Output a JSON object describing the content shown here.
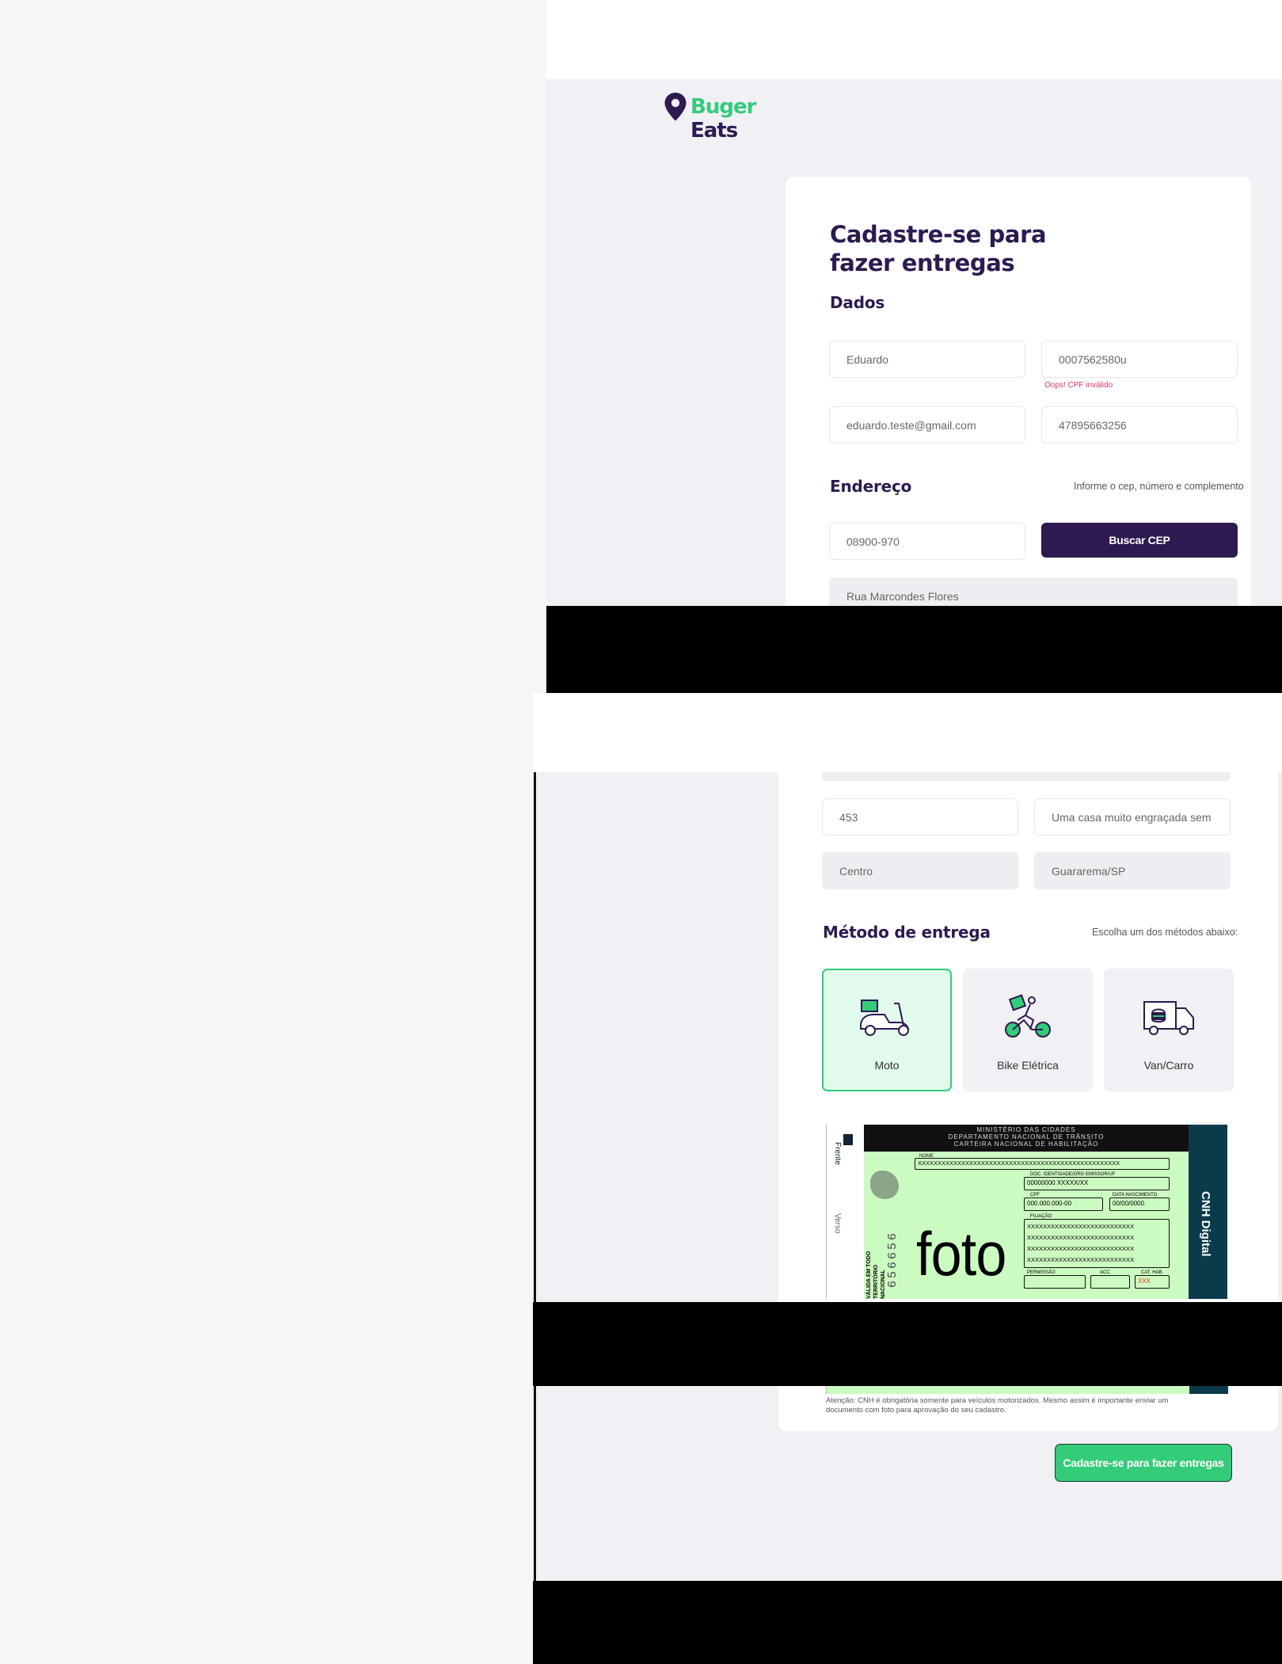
{
  "brand": {
    "part1": "Bug",
    "part2": "er",
    "part3": " Eats"
  },
  "form": {
    "title_line1": "Cadastre-se para",
    "title_line2": "fazer entregas",
    "dados": {
      "heading": "Dados",
      "name": "Eduardo",
      "cpf": "0007562580u",
      "cpf_error": "Oops! CPF inválido",
      "email": "eduardo.teste@gmail.com",
      "whatsapp": "47895663256"
    },
    "endereco": {
      "heading": "Endereço",
      "hint": "Informe o cep, número e complemento",
      "cep": "08900-970",
      "buscar_cep": "Buscar CEP",
      "rua": "Rua Marcondes Flores",
      "numero": "453",
      "complemento": "Uma casa muito engraçada sem l",
      "bairro": "Centro",
      "cidade": "Guararema/SP"
    },
    "metodo": {
      "heading": "Método de entrega",
      "hint": "Escolha um dos métodos abaixo:",
      "options": [
        {
          "label": "Moto",
          "icon": "moto-icon",
          "selected": true
        },
        {
          "label": "Bike Elétrica",
          "icon": "bike-icon",
          "selected": false
        },
        {
          "label": "Van/Carro",
          "icon": "van-icon",
          "selected": false
        }
      ]
    },
    "cnh": {
      "side_frente": "Frente",
      "side_verso": "Verso",
      "ministerio": "MINISTÉRIO DAS CIDADES",
      "departamento": "DEPARTAMENTO NACIONAL DE TRÂNSITO",
      "carteira": "CARTEIRA NACIONAL DE HABILITAÇÃO",
      "nome_label": "NOME",
      "nome_value": "XXXXXXXXXXXXXXXXXXXXXXXXXXXXXXXXXXXXXXXXXXXXXXXXXXX",
      "doc_label": "DOC. IDENTIDADE/ÓRG EMISSOR/UF",
      "doc_value": "00000000  XXXXX/XX",
      "cpf_label": "CPF",
      "cpf_value": "000.000.000-00",
      "nasc_label": "DATA NASCIMENTO",
      "nasc_value": "00/00/0000",
      "filiacao_label": "FILIAÇÃO",
      "filiacao_value": "XXXXXXXXXXXXXXXXXXXXXXXXXXX",
      "permissao_label": "PERMISSÃO",
      "acc_label": "ACC",
      "cat_label": "CAT. HAB.",
      "cat_value": "XXX",
      "foto": "foto",
      "validade": "VÁLIDA EM TODO",
      "territorio": "TERRITÓRIO NACIONAL",
      "numero": "656656",
      "cnh_digital": "CNH Digital"
    },
    "note_line1": "Atenção: CNH é obrigatória somente para veículos motorizados. Mesmo assim é importante enviar um",
    "note_line2": "documento com foto para aprovação do seu cadastro.",
    "submit": "Cadastre-se para fazer entregas"
  },
  "colors": {
    "primary": "#2d1a50",
    "accent": "#34cb79",
    "error": "#e8336b",
    "background": "#f0f0f5"
  }
}
